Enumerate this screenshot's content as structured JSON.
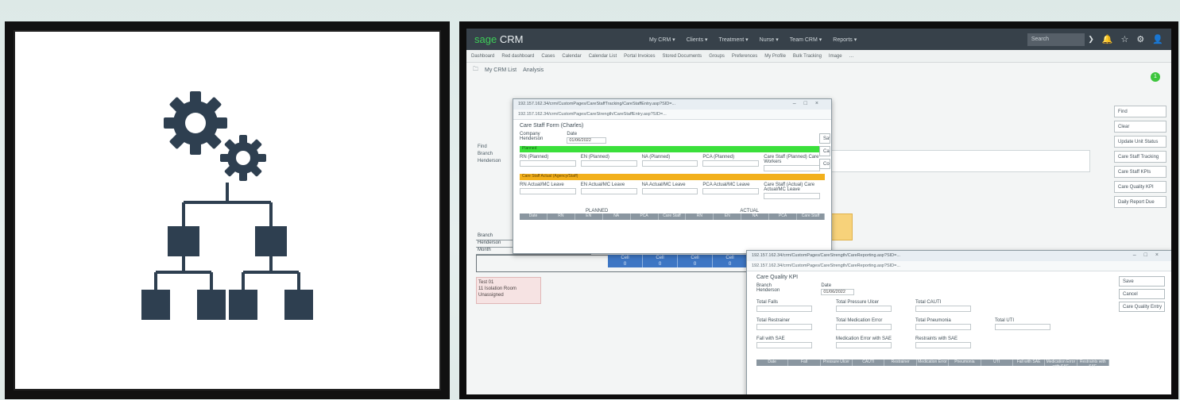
{
  "icon_panel": {
    "icon": "gears-org-chart-icon"
  },
  "crm": {
    "logo_brand": "sage",
    "logo_product": "CRM",
    "top_menu": [
      "My CRM ▾",
      "Clients ▾",
      "Treatment ▾",
      "Nurse ▾",
      "Team CRM ▾",
      "Reports ▾"
    ],
    "search_placeholder": "Search",
    "search_chevron": "❯",
    "top_icons": [
      "🔔",
      "☆",
      "⚙",
      "👤"
    ],
    "tabs": [
      "Dashboard",
      "Red dashboard",
      "Cases",
      "Calendar",
      "Calendar List",
      "Portal Invoices",
      "Stored Documents",
      "Groups",
      "Preferences",
      "My Profile",
      "Bulk Tracking",
      "Image",
      "…"
    ],
    "crumbs": [
      "My CRM List",
      "Analysis"
    ],
    "badge": "1",
    "side_buttons": [
      "Find",
      "Clear",
      "Update Unit Status",
      "Care Staff Tracking",
      "Care Staff KPIs",
      "Care Quality KPI",
      "Daily Report Due"
    ],
    "background": {
      "find_label": "Find",
      "branch_label": "Branch",
      "branch_value": "Henderson",
      "rows": [
        "Branch",
        "Henderson",
        "Month",
        "Isolation Room"
      ],
      "cells": [
        [
          "Cell",
          "0"
        ],
        [
          "Cell",
          "0"
        ],
        [
          "Cell",
          "0"
        ],
        [
          "Cell",
          "0"
        ]
      ],
      "amber_text": "Report",
      "pink_lines": [
        "Test 01",
        "11 Isolation Room",
        "Unassigned"
      ]
    },
    "dialog1": {
      "title": "192.157.162.34/crm/CustomPages/CareStaffTracking/CareStaffEntry.asp?SID=...",
      "url": "192.157.162.34/crm/CustomPages/CareStrength/CareStaffEntry.asp?SID=...",
      "form_title": "Care Staff Form (Charles)",
      "left_label": "Company",
      "left_value": "Henderson",
      "date_label": "Date",
      "date_value": "01/06/2022",
      "green_text": "Planned",
      "row1": [
        "RN (Planned)",
        "EN (Planned)",
        "NA (Planned)",
        "PCA (Planned)",
        "Care Staff (Planned) Care Workers"
      ],
      "orange_text": "Care Staff Actual (Agency/Staff)",
      "row2": [
        "RN Actual/MC Leave",
        "EN Actual/MC Leave",
        "NA Actual/MC Leave",
        "PCA Actual/MC Leave",
        "Care Staff (Actual) Care Actual/MC Leave"
      ],
      "planned_label": "PLANNED",
      "actual_label": "ACTUAL",
      "grid_cols": [
        "Date",
        "RN",
        "EN",
        "NA",
        "PCA",
        "Care Staff",
        "RN",
        "EN",
        "NA",
        "PCA",
        "Care Staff"
      ],
      "side": [
        "Sav",
        "Ca",
        "Co"
      ]
    },
    "dialog2": {
      "title": "192.157.162.34/crm/CustomPages/CareStrength/CareReporting.asp?SID=...",
      "url": "192.157.162.34/crm/CustomPages/CareStrength/CareReporting.asp?SID=...",
      "form_title": "Care Quality KPI",
      "branch_label": "Branch",
      "branch_value": "Henderson",
      "date_label": "Date",
      "date_value": "01/06/2022",
      "fields": [
        [
          "Total Falls",
          "Total Pressure Ulcer",
          "Total CAUTI",
          ""
        ],
        [
          "Total Restrainer",
          "Total Medication Error",
          "Total Pneumonia",
          "Total UTI"
        ],
        [
          "Fall with SAE",
          "Medication Error with SAE",
          "Restraints with SAE",
          ""
        ]
      ],
      "grid_cols": [
        "Date",
        "Fall",
        "Pressure Ulcer",
        "CAUTI",
        "Restrainer",
        "Medication Error",
        "Pneumonia",
        "UTI",
        "Fall with SAE",
        "Medication Error with SAE",
        "Restraints with SAE"
      ],
      "buttons": [
        "Save",
        "Cancel",
        "Care Quality Entry"
      ]
    }
  }
}
